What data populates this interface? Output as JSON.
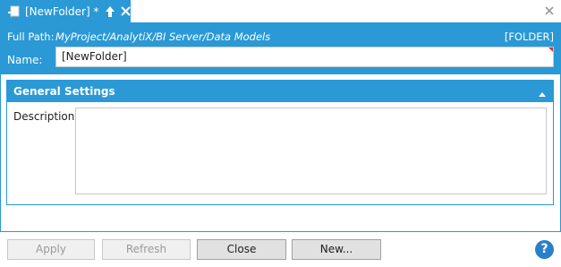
{
  "tab": {
    "title": "[NewFolder] *",
    "icon": "document-icon",
    "pin_icon": "pin-icon",
    "close_icon": "close-icon"
  },
  "header": {
    "fullpath_label": "Full Path:",
    "fullpath_value": "MyProject/AnalytiX/BI Server/Data Models",
    "object_type": "[FOLDER]",
    "name_label": "Name:",
    "name_value": "[NewFolder]"
  },
  "section": {
    "title": "General Settings",
    "description_label": "Description:",
    "description_value": ""
  },
  "footer": {
    "apply_label": "Apply",
    "refresh_label": "Refresh",
    "close_label": "Close",
    "new_label": "New...",
    "help_label": "?"
  },
  "colors": {
    "accent": "#2a99d6",
    "required_marker": "#d9342b"
  }
}
